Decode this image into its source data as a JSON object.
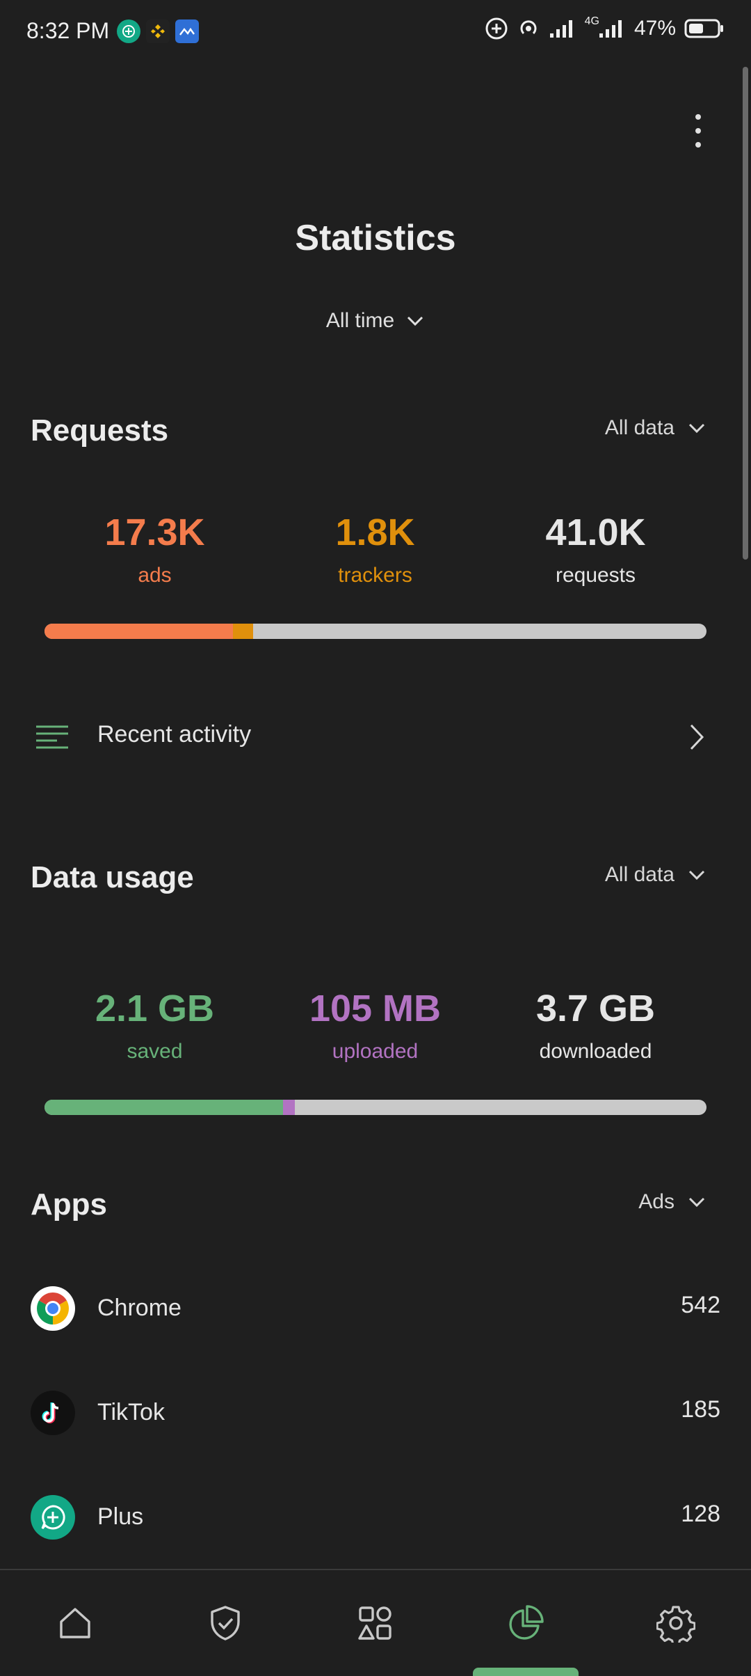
{
  "status_bar": {
    "time": "8:32 PM",
    "battery": "47%",
    "network": "4G"
  },
  "header": {
    "title": "Statistics",
    "time_filter": "All time",
    "menu_icon": "more-vertical-icon"
  },
  "requests": {
    "title": "Requests",
    "filter": "All data",
    "stats": [
      {
        "value": "17.3K",
        "label": "ads",
        "color": "#f47c4c"
      },
      {
        "value": "1.8K",
        "label": "trackers",
        "color": "#e0900c"
      },
      {
        "value": "41.0K",
        "label": "requests",
        "color": "#e6e6e6"
      }
    ],
    "bar": {
      "ads_fraction": 0.285,
      "trackers_fraction": 0.03
    }
  },
  "recent_activity": {
    "label": "Recent activity",
    "icon": "list-icon"
  },
  "data_usage": {
    "title": "Data usage",
    "filter": "All data",
    "stats": [
      {
        "value": "2.1 GB",
        "label": "saved",
        "color": "#67b279"
      },
      {
        "value": "105 MB",
        "label": "uploaded",
        "color": "#b273c2"
      },
      {
        "value": "3.7 GB",
        "label": "downloaded",
        "color": "#e6e6e6"
      }
    ],
    "bar": {
      "saved_fraction": 0.36,
      "uploaded_fraction": 0.018
    }
  },
  "apps": {
    "title": "Apps",
    "filter": "Ads",
    "items": [
      {
        "name": "Chrome",
        "count": "542",
        "icon": "chrome-icon"
      },
      {
        "name": "TikTok",
        "count": "185",
        "icon": "tiktok-icon"
      },
      {
        "name": "Plus",
        "count": "128",
        "icon": "plus-app-icon"
      }
    ]
  },
  "bottom_nav": {
    "items": [
      "home-icon",
      "shield-check-icon",
      "apps-grid-icon",
      "statistics-icon",
      "settings-icon"
    ],
    "active_index": 3,
    "accent": "#67b279"
  }
}
